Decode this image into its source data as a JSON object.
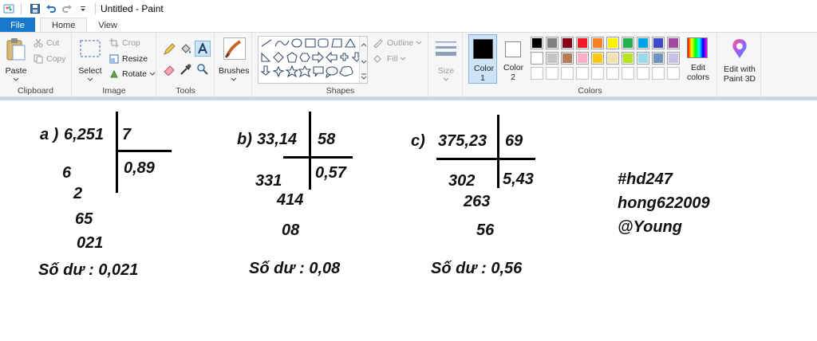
{
  "titlebar": {
    "title": "Untitled - Paint"
  },
  "tabs": {
    "file": "File",
    "home": "Home",
    "view": "View"
  },
  "clipboard": {
    "paste": "Paste",
    "cut": "Cut",
    "copy": "Copy",
    "label": "Clipboard"
  },
  "image": {
    "select": "Select",
    "crop": "Crop",
    "resize": "Resize",
    "rotate": "Rotate",
    "label": "Image"
  },
  "tools": {
    "label": "Tools"
  },
  "brushes": {
    "label": "Brushes"
  },
  "shapes": {
    "outline": "Outline",
    "fill": "Fill",
    "label": "Shapes"
  },
  "size": {
    "label": "Size"
  },
  "colors": {
    "color1": "Color 1",
    "color2": "Color 2",
    "edit": "Edit colors",
    "label": "Colors",
    "color1_value": "#000000",
    "color2_value": "#ffffff",
    "row1": [
      "#000000",
      "#7f7f7f",
      "#880015",
      "#ed1c24",
      "#ff7f27",
      "#fff200",
      "#22b14c",
      "#00a2e8",
      "#3f48cc",
      "#a349a4"
    ],
    "row2": [
      "#ffffff",
      "#c3c3c3",
      "#b97a57",
      "#ffaec9",
      "#ffc90e",
      "#efe4b0",
      "#b5e61d",
      "#99d9ea",
      "#7092be",
      "#c8bfe7"
    ],
    "row3": [
      "#ffffff",
      "#ffffff",
      "#ffffff",
      "#ffffff",
      "#ffffff",
      "#ffffff",
      "#ffffff",
      "#ffffff",
      "#ffffff",
      "#ffffff"
    ]
  },
  "paint3d": {
    "label": "Edit with Paint 3D"
  },
  "canvas": {
    "a": {
      "label": "a )",
      "dividend": "6,251",
      "divisor": "7",
      "quotient": "0,89",
      "steps": [
        "6",
        "2",
        "65",
        "021"
      ],
      "remainder": "Số dư : 0,021"
    },
    "b": {
      "label": "b)",
      "dividend": "33,14",
      "divisor": "58",
      "quotient": "0,57",
      "steps": [
        "331",
        "414",
        "08"
      ],
      "remainder": "Số dư : 0,08"
    },
    "c": {
      "label": "c)",
      "dividend": "375,23",
      "divisor": "69",
      "quotient": "5,43",
      "steps": [
        "302",
        "263",
        "56"
      ],
      "remainder": "Số dư : 0,56"
    },
    "tags": [
      "#hd247",
      "hong622009",
      "@Young"
    ]
  }
}
